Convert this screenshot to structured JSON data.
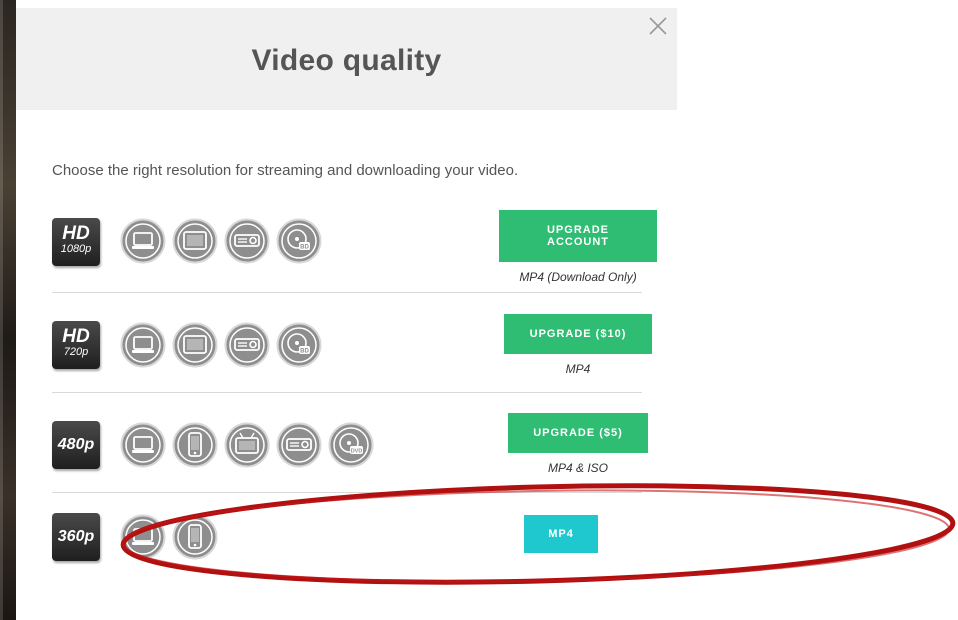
{
  "modal": {
    "title": "Video quality",
    "intro": "Choose the right resolution for streaming and downloading your video."
  },
  "rows": [
    {
      "badge_top": "HD",
      "badge_res": "1080p",
      "devices": [
        "laptop-icon",
        "tablet-icon",
        "projector-icon",
        "bluray-disc-icon"
      ],
      "button_label": "UPGRADE ACCOUNT",
      "button_color": "#2fbc73",
      "format": "MP4 (Download Only)"
    },
    {
      "badge_top": "HD",
      "badge_res": "720p",
      "devices": [
        "laptop-icon",
        "tablet-icon",
        "projector-icon",
        "bluray-disc-icon"
      ],
      "button_label": "UPGRADE ($10)",
      "button_color": "#2fbc73",
      "format": "MP4"
    },
    {
      "badge_res": "480p",
      "devices": [
        "laptop-icon",
        "phone-icon",
        "tv-icon",
        "projector-icon",
        "dvd-disc-icon"
      ],
      "button_label": "UPGRADE ($5)",
      "button_color": "#2fbc73",
      "format": "MP4 & ISO"
    },
    {
      "badge_res": "360p",
      "devices": [
        "laptop-icon",
        "phone-icon"
      ],
      "button_label": "MP4",
      "button_color": "#1fc8cf",
      "format": ""
    }
  ],
  "colors": {
    "header_bg": "#f0f0f0",
    "upgrade_green": "#2fbc73",
    "download_teal": "#1fc8cf",
    "highlight_red": "#b01010",
    "device_icon_gray": "#8e8e8e"
  }
}
